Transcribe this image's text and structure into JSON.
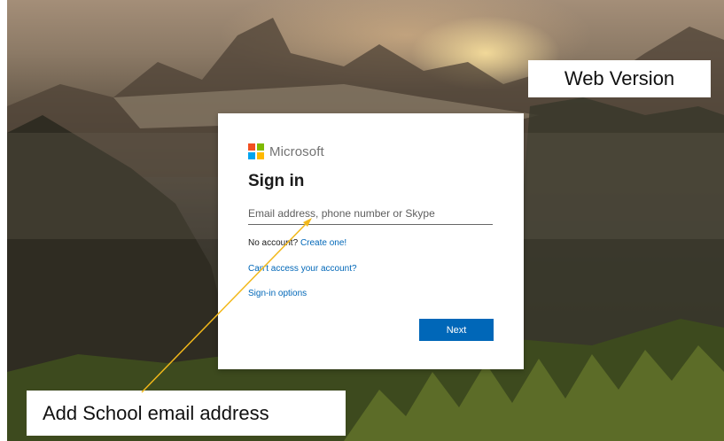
{
  "signin_card": {
    "brand": "Microsoft",
    "title": "Sign in",
    "email_placeholder": "Email address, phone number or Skype",
    "no_account_text": "No account?",
    "create_link": "Create one!",
    "cant_access_link": "Can't access your account?",
    "signin_options_link": "Sign-in options",
    "next_label": "Next"
  },
  "annotations": {
    "web_version": "Web Version",
    "add_school_email": "Add School email address"
  },
  "colors": {
    "accent": "#0067b8",
    "arrow": "#f2b81a",
    "logo_red": "#f25022",
    "logo_green": "#7fba00",
    "logo_blue": "#00a4ef",
    "logo_yellow": "#ffb900"
  },
  "icons": [
    "microsoft-logo-icon",
    "arrow-icon"
  ]
}
